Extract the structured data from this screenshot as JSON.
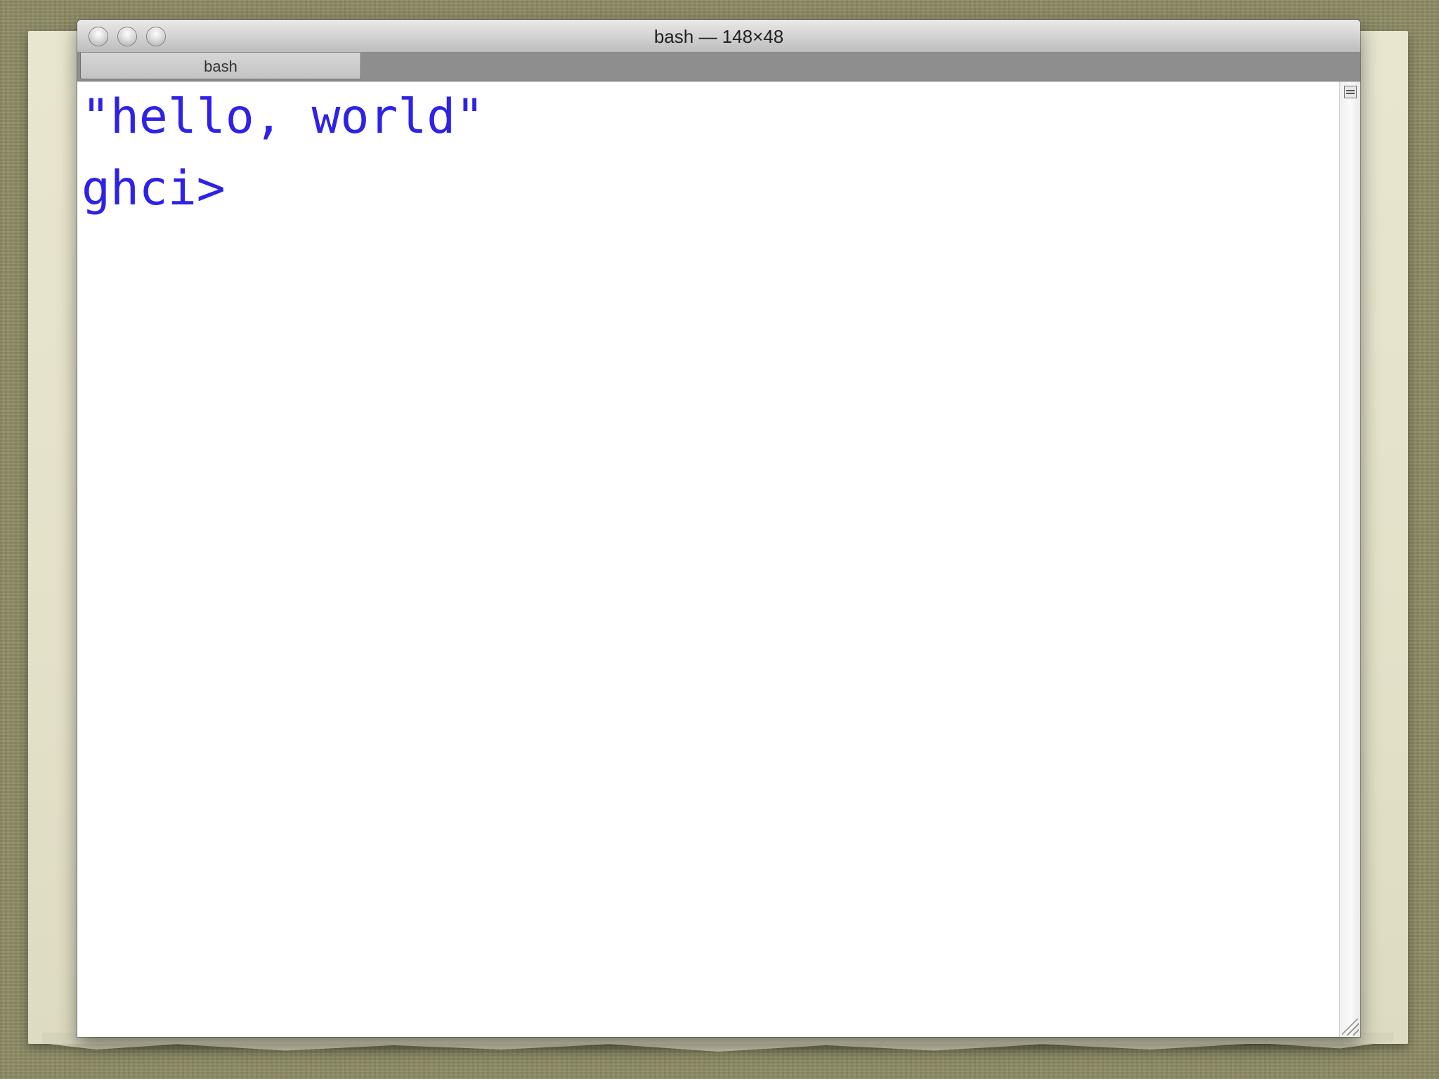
{
  "window": {
    "title": "bash — 148×48"
  },
  "tabs": [
    {
      "label": "bash",
      "active": true
    }
  ],
  "terminal": {
    "text_color": "#2e22e6",
    "lines": [
      "\"hello, world\"",
      "ghci>"
    ]
  },
  "icons": {
    "traffic_lights": [
      "close-icon",
      "minimize-icon",
      "zoom-icon"
    ],
    "split": "split-pane-icon",
    "resize": "resize-grip-icon"
  }
}
